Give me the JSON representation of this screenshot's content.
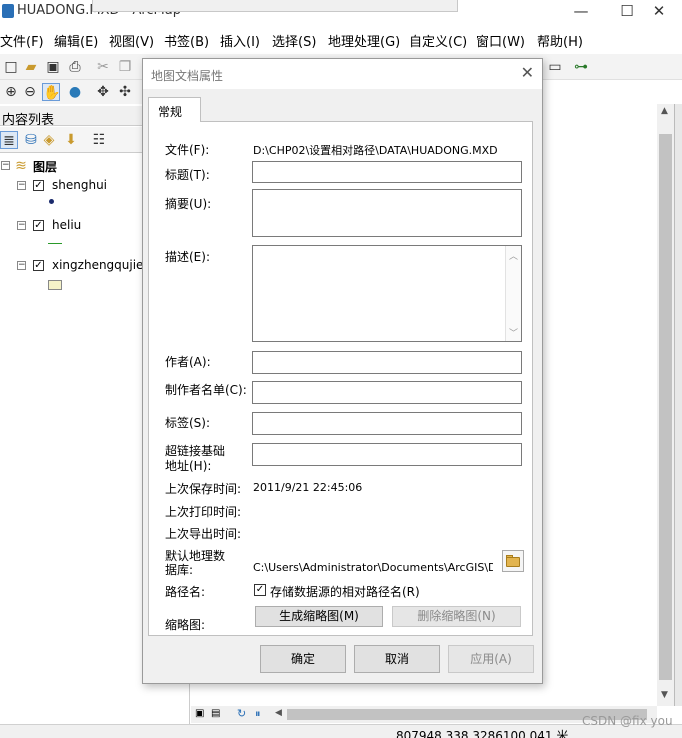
{
  "app": {
    "title": "HUADONG.MXD - ArcMap",
    "minimize": "—",
    "maximize": "☐",
    "close": "✕"
  },
  "menu": [
    "文件(F)",
    "编辑(E)",
    "视图(V)",
    "书签(B)",
    "插入(I)",
    "选择(S)",
    "地理处理(G)",
    "自定义(C)",
    "窗口(W)",
    "帮助(H)"
  ],
  "toc": {
    "title": "内容列表",
    "root_label": "图层",
    "layers": [
      {
        "name": "shenghui",
        "checked": true
      },
      {
        "name": "heliu",
        "checked": true
      },
      {
        "name": "xingzhengqujie",
        "checked": true
      }
    ]
  },
  "status": {
    "coords": "807948.338 3286100.041 米",
    "watermark": "CSDN @fix you"
  },
  "dialog": {
    "title": "地图文档属性",
    "tab": "常规",
    "file_label": "文件(F):",
    "file_value": "D:\\CHP02\\设置相对路径\\DATA\\HUADONG.MXD",
    "title_label": "标题(T):",
    "title_value": "",
    "summary_label": "摘要(U):",
    "summary_value": "",
    "description_label": "描述(E):",
    "description_value": "",
    "author_label": "作者(A):",
    "author_value": "",
    "credits_label": "制作者名单(C):",
    "credits_value": "",
    "tags_label": "标签(S):",
    "tags_value": "",
    "hyperlink_label_1": "超链接基础",
    "hyperlink_label_2": "地址(H):",
    "hyperlink_value": "",
    "last_saved_label": "上次保存时间:",
    "last_saved_value": "2011/9/21 22:45:06",
    "last_printed_label": "上次打印时间:",
    "last_exported_label": "上次导出时间:",
    "default_gdb_label_1": "默认地理数",
    "default_gdb_label_2": "据库:",
    "default_gdb_value": "C:\\Users\\Administrator\\Documents\\ArcGIS\\Defaul",
    "pathnames_label": "路径名:",
    "relative_paths_label": "存储数据源的相对路径名(R)",
    "relative_paths_checked": true,
    "thumbnail_label": "缩略图:",
    "make_thumbnail": "生成缩略图(M)",
    "delete_thumbnail": "删除缩略图(N)",
    "ok": "确定",
    "cancel": "取消",
    "apply": "应用(A)"
  }
}
